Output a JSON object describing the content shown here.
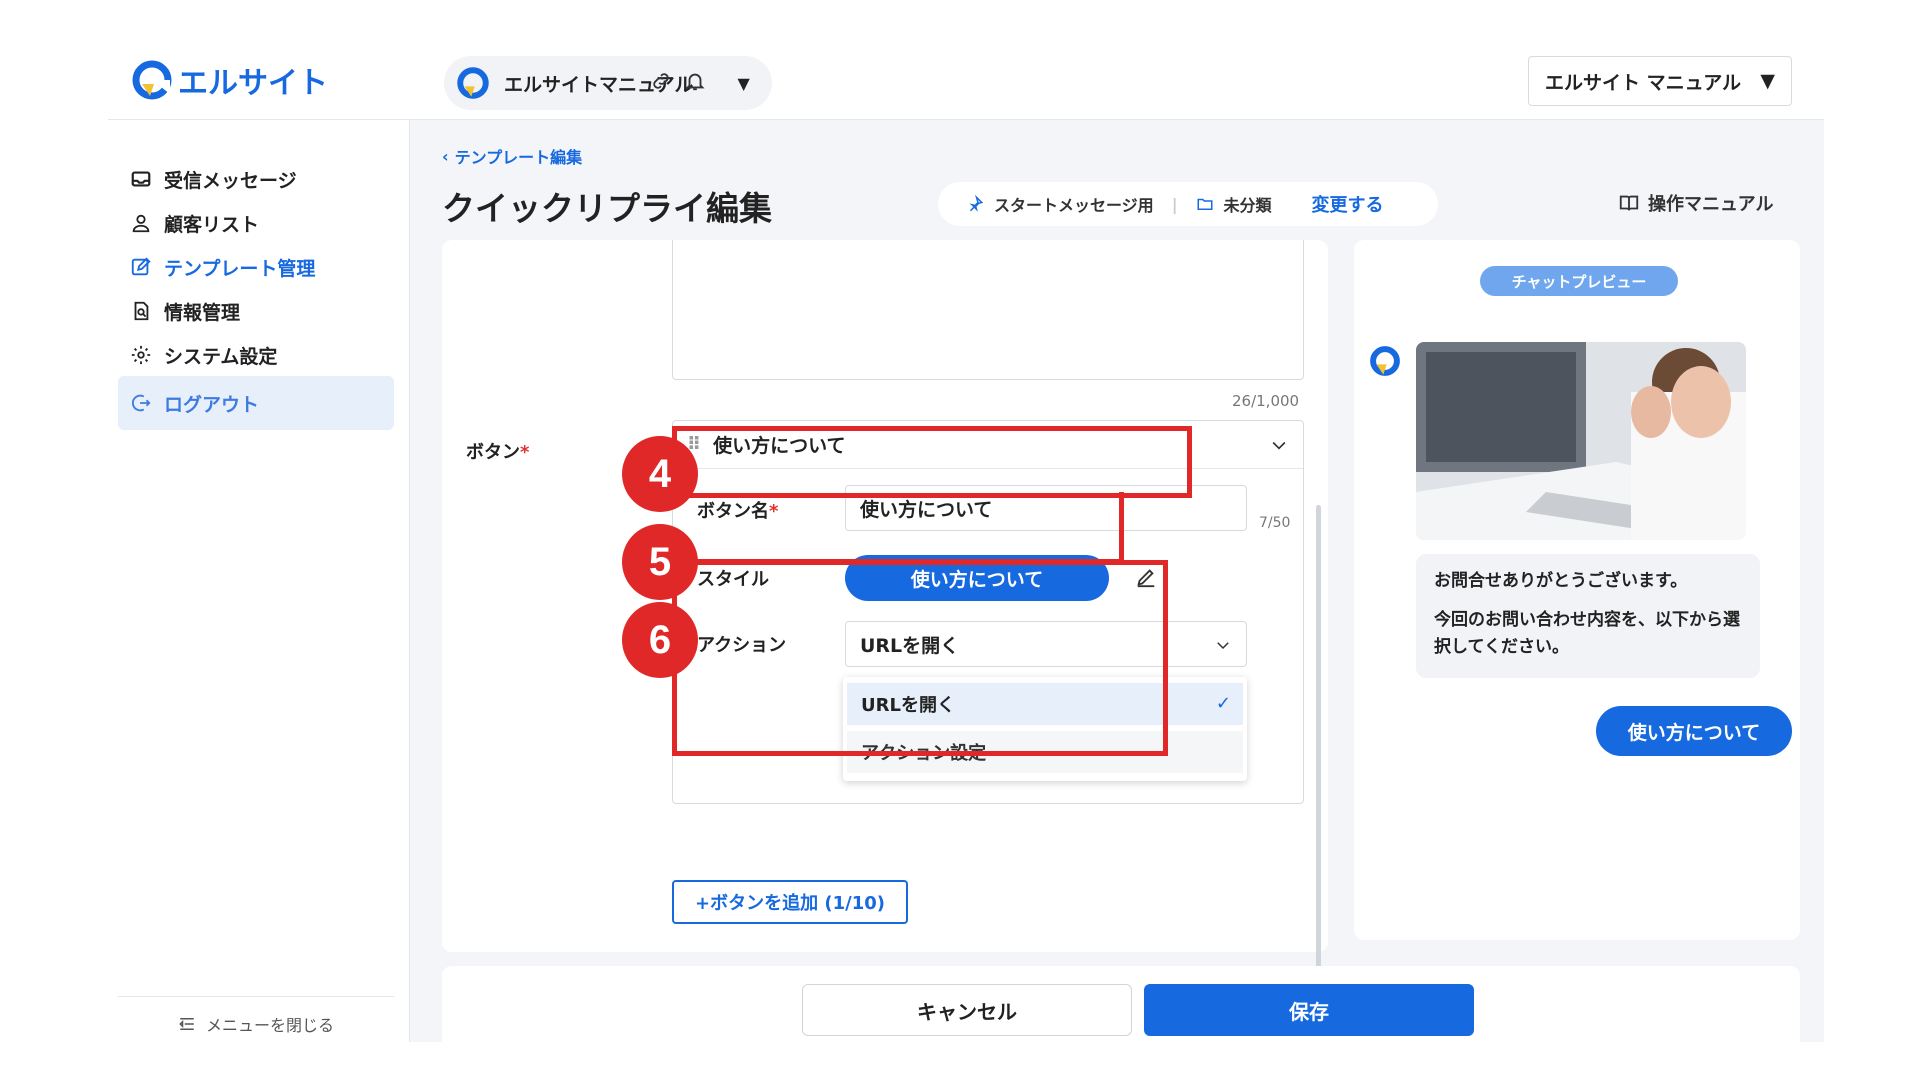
{
  "header": {
    "logo_text": "エルサイト",
    "account_name": "エルサイトマニュアル",
    "right_select_value": "エルサイト マニュアル"
  },
  "sidebar": {
    "items": [
      {
        "label": "受信メッセージ",
        "icon": "inbox-icon"
      },
      {
        "label": "顧客リスト",
        "icon": "user-icon"
      },
      {
        "label": "テンプレート管理",
        "icon": "edit-icon"
      },
      {
        "label": "情報管理",
        "icon": "document-search-icon"
      },
      {
        "label": "システム設定",
        "icon": "gear-icon"
      },
      {
        "label": "ログアウト",
        "icon": "logout-icon"
      }
    ],
    "close_menu": "メニューを閉じる"
  },
  "main": {
    "breadcrumb": "テンプレート編集",
    "title": "クイックリプライ編集",
    "meta": {
      "usage": "スタートメッセージ用",
      "folder": "未分類",
      "change": "変更する"
    },
    "manual_link": "操作マニュアル"
  },
  "editor": {
    "char_count": "26/1,000",
    "button_label": "ボタン",
    "required_mark": "*",
    "group_title": "使い方について",
    "name_label": "ボタン名",
    "name_value": "使い方について",
    "name_count": "7/50",
    "style_label": "スタイル",
    "style_button": "使い方について",
    "action_label": "アクション",
    "action_value": "URLを開く",
    "dropdown_options": [
      "URLを開く",
      "アクション設定"
    ],
    "add_button": "+ボタンを追加 (1/10)"
  },
  "annotations": {
    "markers": [
      "4",
      "5",
      "6"
    ],
    "color": "#e02828"
  },
  "preview": {
    "badge": "チャットプレビュー",
    "message_1": "お問合せありがとうございます。",
    "message_2": "今回のお問い合わせ内容を、以下から選択してください。",
    "quick_reply": "使い方について"
  },
  "footer": {
    "cancel": "キャンセル",
    "save": "保存"
  },
  "colors": {
    "accent": "#1769e0",
    "annotation": "#e02828"
  }
}
